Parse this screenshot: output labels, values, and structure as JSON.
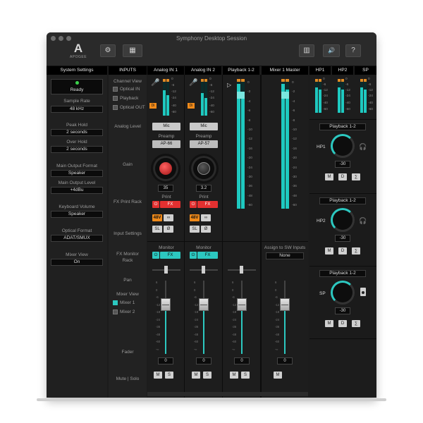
{
  "window": {
    "title": "Symphony Desktop Session"
  },
  "logo": {
    "mark": "A",
    "word": "APOGEE"
  },
  "toolbar": {
    "gear_icon": "gear-icon",
    "settings_glyph": "⚙",
    "layout_glyph": "▦",
    "meters_glyph": "▥",
    "speaker_glyph": "🔊",
    "help_glyph": "?"
  },
  "headers": {
    "system": "System Settings",
    "inputs": "INPUTS",
    "analog1": "Analog IN 1",
    "analog2": "Analog IN 2",
    "playback": "Playback 1-2",
    "mixer": "Mixer 1 Master",
    "hp1": "HP1",
    "hp2": "HP2",
    "sp": "SP"
  },
  "system": {
    "status": "Ready",
    "sample_rate_label": "Sample Rate",
    "sample_rate": "48 kHz",
    "peak_hold_label": "Peak Hold",
    "peak_hold": "2 seconds",
    "over_hold_label": "Over Hold",
    "over_hold": "2 seconds",
    "main_output_format_label": "Main Output Format",
    "main_output_format": "Speaker",
    "main_output_level_label": "Main Output Level",
    "main_output_level": "+4dBu",
    "keyboard_volume_label": "Keyboard Volume",
    "keyboard_volume": "Speaker",
    "optical_format_label": "Optical Format",
    "optical_format": "ADAT/SMUX",
    "mixer_view_label": "Mixer View",
    "mixer_view": "On"
  },
  "inputs_labels": {
    "channel_view": "Channel View",
    "optical_in": "Optical IN",
    "playback": "Playback",
    "optical_out": "Optical OUT",
    "analog_level": "Analog Level",
    "gain": "Gain",
    "fx_print_rack": "FX Print Rack",
    "input_settings": "Input Settings",
    "fx_monitor_rack": "FX Monitor Rack",
    "pan": "Pan",
    "mixer_view": "Mixer View",
    "mixer1": "Mixer 1",
    "mixer2": "Mixer 2",
    "fader": "Fader",
    "mute_solo": "Mute | Solo"
  },
  "meter_scale": [
    "0",
    "-6",
    "-12",
    "-24",
    "-40",
    "-60"
  ],
  "play_scale": [
    "0",
    "-2",
    "-4",
    "-6",
    "-8",
    "-10",
    "-12",
    "-16",
    "-20",
    "-24",
    "-30",
    "-36",
    "-48",
    "-60"
  ],
  "ch1": {
    "di": "Di",
    "level": "Mic",
    "preamp_label": "Preamp",
    "preamp": "AP-66",
    "gain": "35",
    "print_label": "Print",
    "fx": "FX",
    "v48": "48V",
    "sl": "SL",
    "phase": "Ø",
    "monitor_label": "Monitor",
    "fader_value": "0",
    "mute": "M",
    "solo": "S"
  },
  "ch2": {
    "di": "Di",
    "level": "Mic",
    "preamp_label": "Preamp",
    "preamp": "AP-57",
    "gain": "3.2",
    "print_label": "Print",
    "fx": "FX",
    "v48": "48V",
    "sl": "SL",
    "phase": "Ø",
    "monitor_label": "Monitor",
    "fader_value": "0",
    "mute": "M",
    "solo": "S"
  },
  "playback": {
    "fader_value": "0",
    "mute": "M",
    "solo": "S"
  },
  "master": {
    "assign_label": "Assign to SW Inputs",
    "assign_value": "None",
    "fader_value": "0",
    "mute": "M"
  },
  "outputs": [
    {
      "source": "Playback 1-2",
      "name": "HP1",
      "value": "-30",
      "m": "M",
      "d": "D",
      "sum": "∑"
    },
    {
      "source": "Playback 1-2",
      "name": "HP2",
      "value": "-30",
      "m": "M",
      "d": "D",
      "sum": "∑"
    },
    {
      "source": "Playback 1-2",
      "name": "SP",
      "value": "-30",
      "m": "M",
      "d": "D",
      "sum": "∑"
    }
  ],
  "fader_scale": [
    "6",
    "0",
    "-6",
    "-12",
    "-18",
    "-24",
    "-36",
    "-48",
    "-60",
    "-∞"
  ],
  "colors": {
    "accent": "#2cc8c0",
    "alert": "#e33030",
    "phantom": "#f08a1a",
    "peak": "#e08a24"
  }
}
